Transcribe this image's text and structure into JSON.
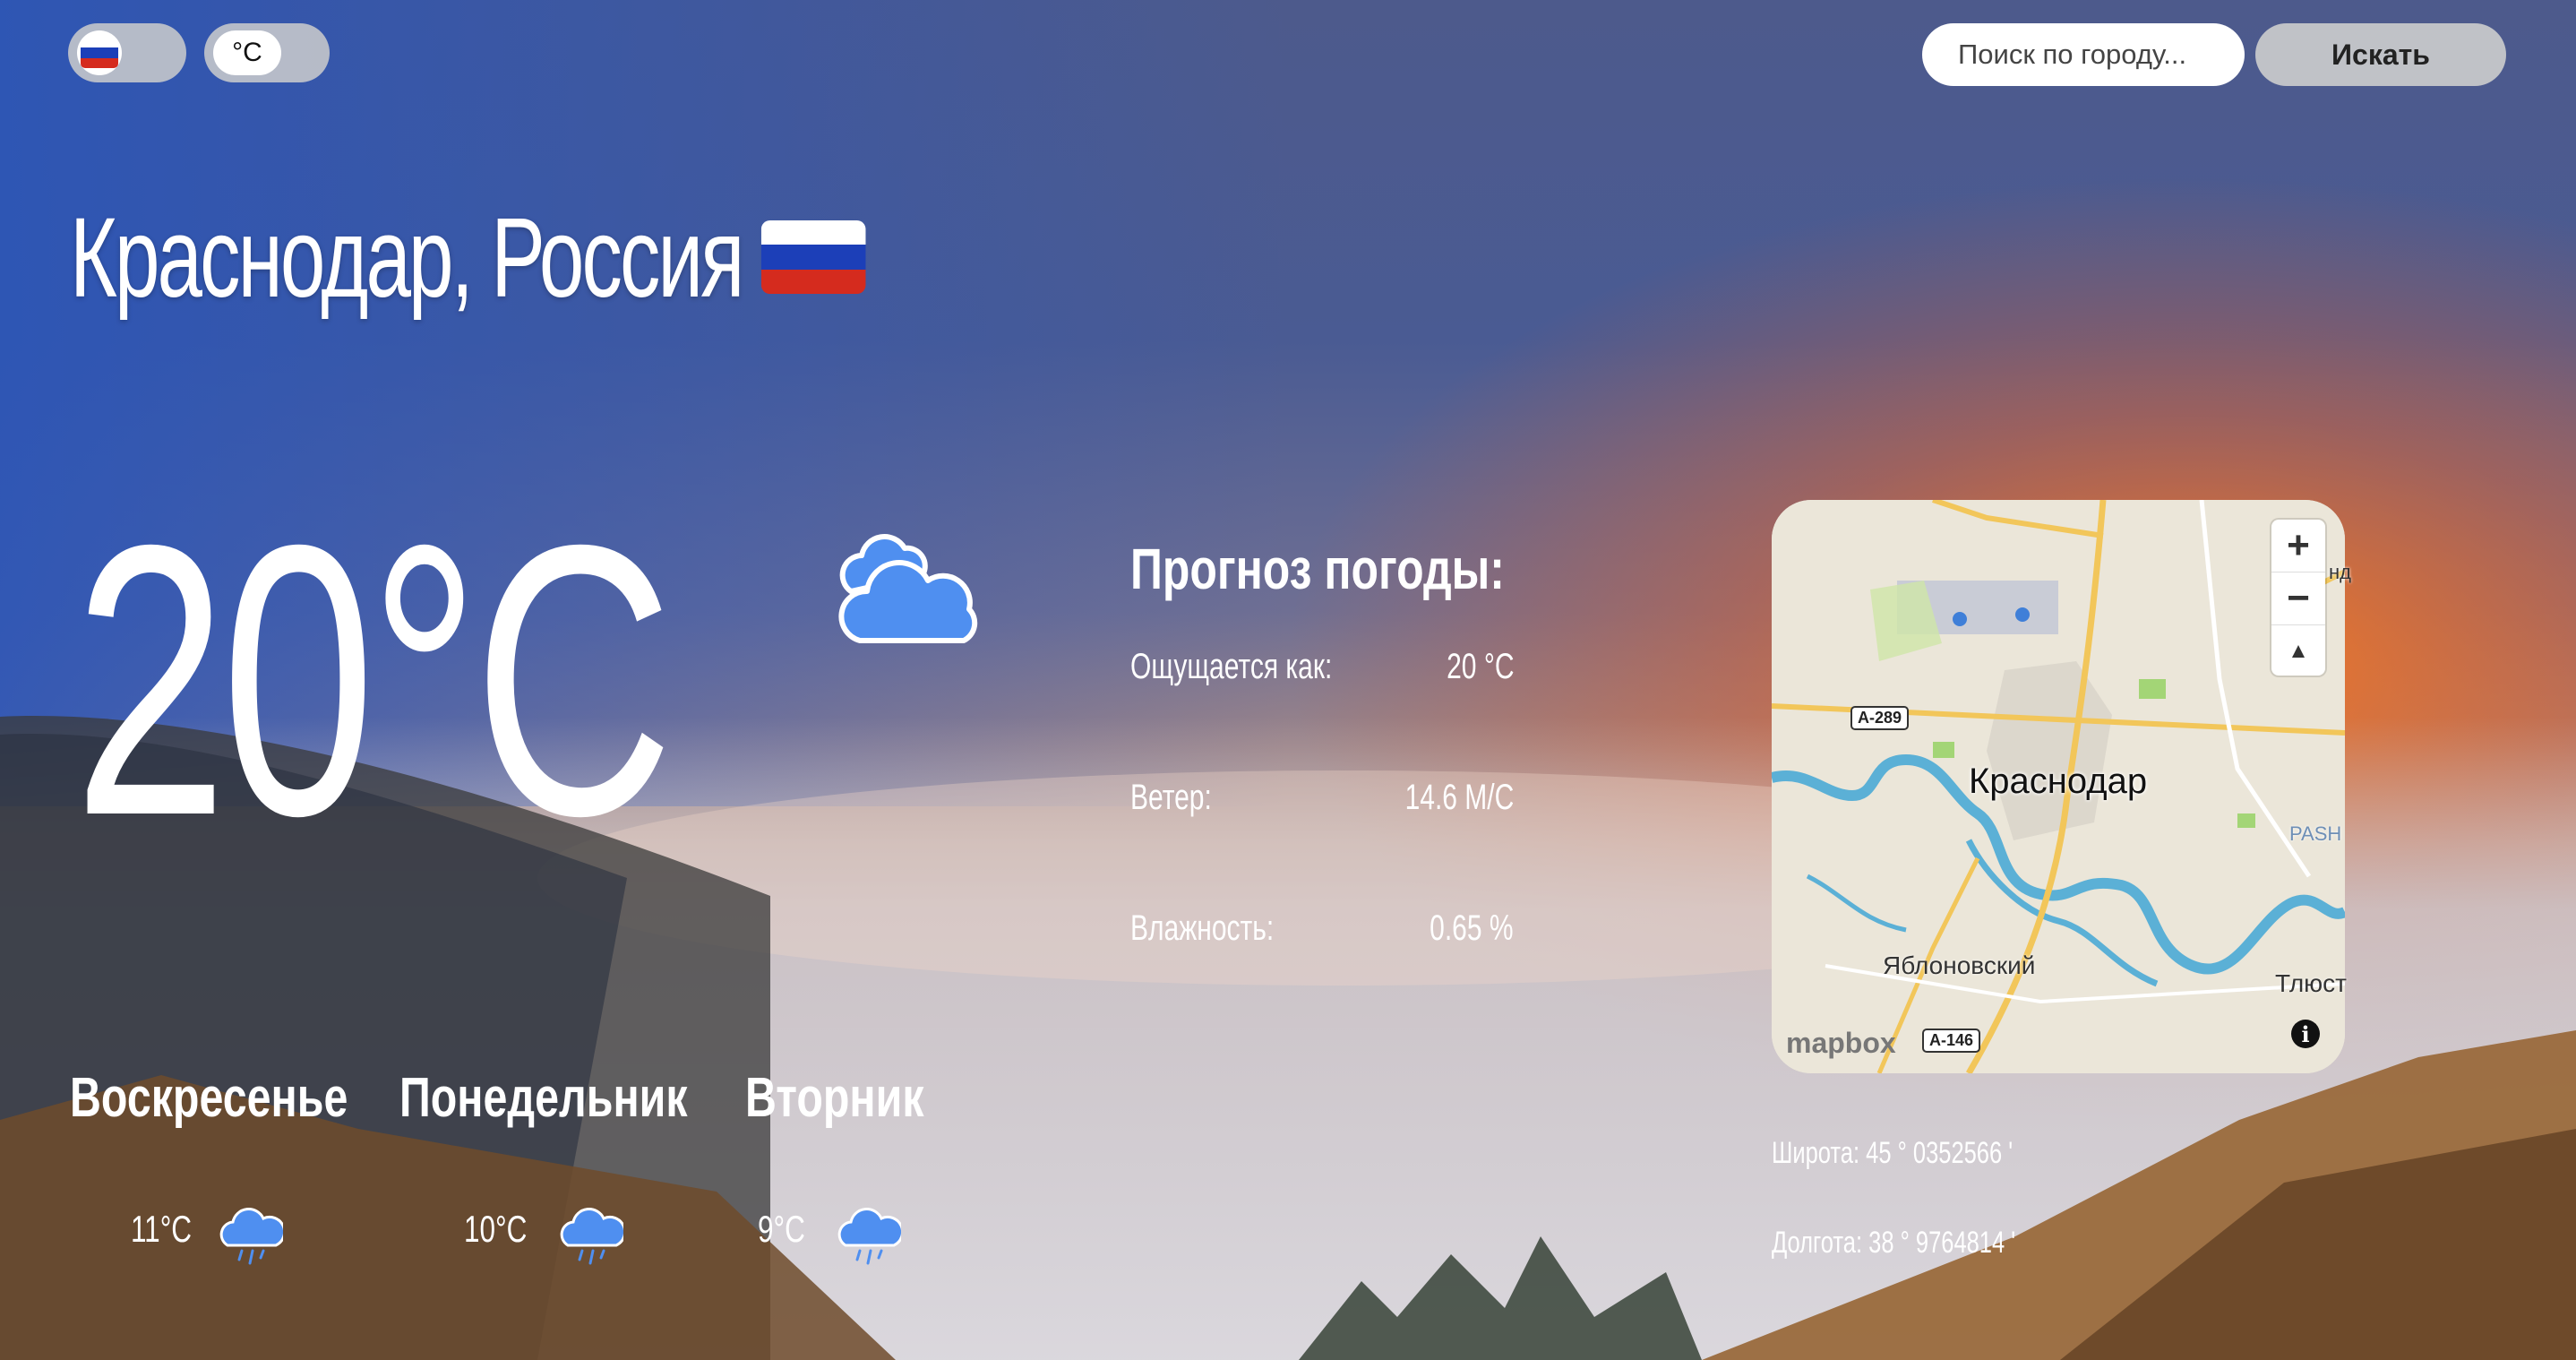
{
  "settings": {
    "language_flag": "ru-flag",
    "unit_label": "°C"
  },
  "search": {
    "placeholder": "Поиск по городу...",
    "button_label": "Искать"
  },
  "location": {
    "title": "Краснодар, Россия",
    "flag": "ru-flag"
  },
  "current": {
    "temperature": "20°C",
    "icon": "cloud-icon"
  },
  "forecast": {
    "title": "Прогноз погоды:",
    "rows": [
      {
        "label": "Ощущается как:",
        "value": "20 °C"
      },
      {
        "label": "Ветер:",
        "value": "14.6 М/С"
      },
      {
        "label": "Влажность:",
        "value": "0.65 %"
      }
    ]
  },
  "days": [
    {
      "name": "Воскресенье",
      "temp": "11°C",
      "icon": "rain-cloud-icon"
    },
    {
      "name": "Понедельник",
      "temp": "10°C",
      "icon": "rain-cloud-icon"
    },
    {
      "name": "Вторник",
      "temp": "9°C",
      "icon": "rain-cloud-icon"
    }
  ],
  "map": {
    "city_label": "Краснодар",
    "labels": {
      "yablonovsky": "Яблоновский",
      "tlust": "Тлюст",
      "pash": "PASH",
      "nd": "нд"
    },
    "shields": [
      "A-289",
      "A-146"
    ],
    "attribution": "mapbox",
    "zoom_in": "+",
    "zoom_out": "−",
    "compass": "▲"
  },
  "coordinates": {
    "latitude": "Широта: 45 ° 0352566 '",
    "longitude": "Долгота: 38 ° 9764814 '"
  },
  "colors": {
    "flag_white": "#ffffff",
    "flag_blue": "#1c3fb8",
    "flag_red": "#d52b1e",
    "icon_blue": "#4f8ff0",
    "river": "#5bb0d6",
    "road": "#f2c65a"
  }
}
